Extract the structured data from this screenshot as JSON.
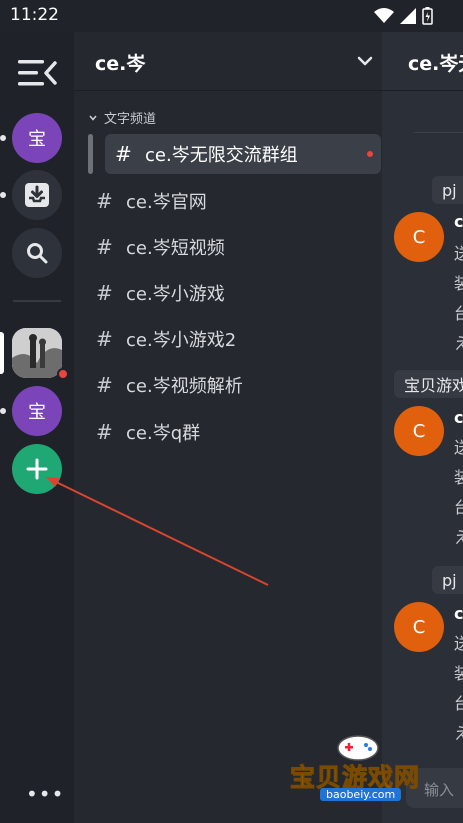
{
  "status_bar": {
    "time": "11:22"
  },
  "rail": {
    "servers": [
      {
        "label": "宝"
      },
      {
        "label": "宝"
      }
    ],
    "more_label": "•••"
  },
  "channel_panel": {
    "server_name": "ce.岑",
    "category": "文字频道",
    "channels": [
      {
        "name": "ce.岑无限交流群组",
        "active": true,
        "unread": true
      },
      {
        "name": "ce.岑官网"
      },
      {
        "name": "ce.岑短视频"
      },
      {
        "name": "ce.岑小游戏"
      },
      {
        "name": "ce.岑小游戏2"
      },
      {
        "name": "ce.岑视频解析"
      },
      {
        "name": "ce.岑q群"
      }
    ],
    "hash_symbol": "#"
  },
  "chat": {
    "title": "ce.岑无",
    "messages": [
      {
        "pill": "pj :",
        "avatar": "C",
        "name": "c",
        "lines": [
          "送",
          "装",
          "台",
          "え"
        ]
      },
      {
        "pill": "宝贝游戏",
        "avatar": "C",
        "name": "c",
        "lines": [
          "送",
          "装",
          "台",
          "え"
        ]
      },
      {
        "pill": "pj :",
        "avatar": "C",
        "name": "c",
        "lines": [
          "送",
          "装",
          "台",
          "え"
        ]
      }
    ],
    "input_placeholder": "输入"
  },
  "watermark": {
    "text": "宝贝游戏网",
    "url": "baobeiy.com"
  },
  "colors": {
    "accent_green": "#1fa874",
    "server_purple": "#7b44b9",
    "avatar_orange": "#e0600e",
    "arrow_red": "#d9452e"
  }
}
